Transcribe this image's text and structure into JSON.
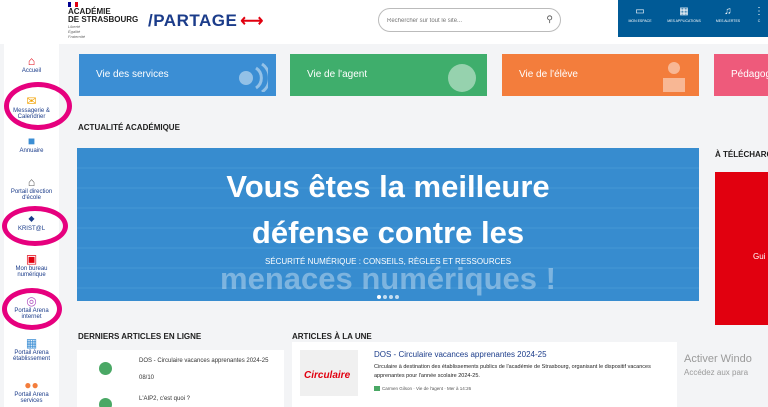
{
  "header": {
    "logo_line1": "ACADÉMIE",
    "logo_line2": "DE STRASBOURG",
    "logo_motto1": "Liberté",
    "logo_motto2": "Égalité",
    "logo_motto3": "Fraternité",
    "brand": "/PARTAGE",
    "brand_icon": "share-icon",
    "search_placeholder": "Rechercher sur tout le site...",
    "nav": [
      {
        "label": "MON ESPACE",
        "icon": "monitor-icon"
      },
      {
        "label": "MES APPLICATIONS",
        "icon": "grid-icon"
      },
      {
        "label": "MES ALERTES",
        "icon": "bell-icon"
      },
      {
        "label": "C",
        "icon": "more-icon"
      }
    ]
  },
  "sidebar": {
    "items": [
      {
        "label": "Accueil",
        "icon": "home-icon"
      },
      {
        "label": "Messagerie & Calendrier",
        "icon": "mail-icon"
      },
      {
        "label": "Annuaire",
        "icon": "book-icon"
      },
      {
        "label": "Portail direction d'école",
        "icon": "school-icon"
      },
      {
        "label": "KRIST@L",
        "icon": "kristal-icon"
      },
      {
        "label": "Mon bureau numérique",
        "icon": "desktop-icon"
      },
      {
        "label": "Portail Arena internet",
        "icon": "globe-icon"
      },
      {
        "label": "Portail Arena établissement",
        "icon": "building-icon"
      },
      {
        "label": "Portail Arena services",
        "icon": "people-icon"
      }
    ]
  },
  "tiles": [
    {
      "label": "Vie des services",
      "color": "#3b8ed4"
    },
    {
      "label": "Vie de l'agent",
      "color": "#3fae6c"
    },
    {
      "label": "Vie de l'élève",
      "color": "#f37d3c"
    },
    {
      "label": "Pédagogie",
      "color": "#ee5a7b"
    }
  ],
  "sections": {
    "news": "ACTUALITÉ ACADÉMIQUE",
    "download": "À TÉLÉCHARGER",
    "latest": "DERNIERS ARTICLES EN LIGNE",
    "featured": "ARTICLES À LA UNE"
  },
  "hero": {
    "line1": "Vous êtes la meilleure",
    "line2": "défense contre les",
    "line3": "menaces numériques !",
    "overline": "SÉCURITÉ NUMÉRIQUE : CONSEILS, RÈGLES ET RESSOURCES",
    "slides": 4,
    "active_slide": 1
  },
  "download_card": {
    "label": "Gui"
  },
  "latest_articles": [
    {
      "title": "DOS - Circulaire vacances apprenantes 2024-25",
      "date": "08/10"
    },
    {
      "title": "L'AIP2, c'est quoi ?",
      "date": ""
    }
  ],
  "featured_article": {
    "thumb_label": "Circulaire",
    "title": "DOS - Circulaire vacances apprenantes 2024-25",
    "description": "Circulaire à destination des établissements publics de l'académie de Strasbourg, organisant le dispositif vacances apprenantes pour l'année scolaire 2024-25.",
    "meta": "Carmen Gilson · Vie de l'agent · Mer à 14:26"
  },
  "watermark": {
    "line1": "Activer Windo",
    "line2": "Accédez aux para"
  },
  "colors": {
    "header_nav": "#005a96",
    "brand": "#1b3c8a",
    "accent_red": "#e1000f",
    "annotation_pink": "#e6007e"
  }
}
